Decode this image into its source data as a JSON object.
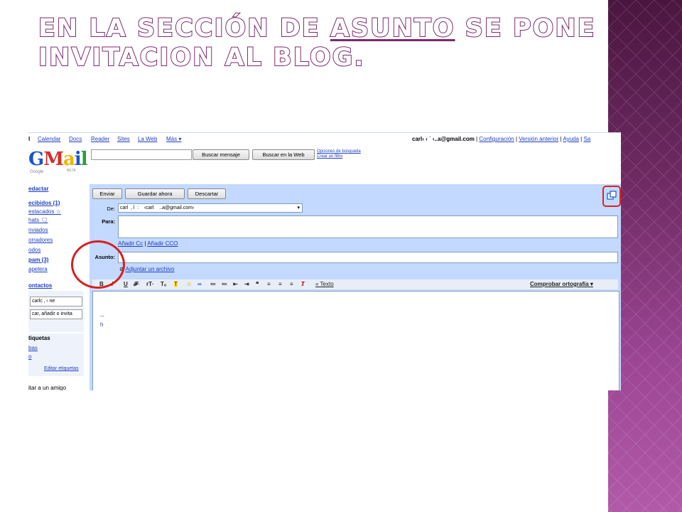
{
  "slide": {
    "title_before": "En la sección de ",
    "title_highlight": "asunto",
    "title_after": " se pone invitacion al blog.",
    "accent": "#7b2a6f",
    "band_color": "#9b4593"
  },
  "gmail": {
    "topnav": [
      "l",
      "Calendar",
      "Docs",
      "Reader",
      "Sites",
      "La Web",
      "Más ▾"
    ],
    "user_email": "carl‹ ‹ ˙ ‹..a@gmail.com",
    "user_links": [
      "Configuración",
      "Versión anterior",
      "Ayuda",
      "Sa"
    ],
    "logo": {
      "text_g": "G",
      "text_m": "M",
      "text_a": "a",
      "text_i": "i",
      "text_l": "l",
      "sub": "Google",
      "beta": "BETA"
    },
    "search": {
      "button_mail": "Buscar mensaje",
      "button_web": "Buscar en la Web",
      "options": "Opciones de búsqueda",
      "filter": "Crear un filtro"
    },
    "leftnav": {
      "compose": "edactar",
      "items": [
        "ecibidos (1)",
        "estacados ☆",
        "hats 🗨",
        "nviados",
        "orradores",
        "odos",
        "pam (3)",
        "apelera"
      ],
      "contacts_title": "ontactos",
      "contact_chip": "carlc  ‚   ‹ ne",
      "contact_search": "car, añadir o invita",
      "labels_title": "tiquetas",
      "label_items": [
        "bas",
        "o"
      ],
      "edit_labels": "Editar etiquetas",
      "invite": "itar a un amigo"
    },
    "compose": {
      "send": "Enviar",
      "save": "Guardar ahora",
      "discard": "Descartar",
      "from_label": "De:",
      "from_value": "carl  ‚ l  :    ‹carl    ..a@gmail.com›",
      "to_label": "Para:",
      "add_cc": "Añadir Cc",
      "add_bcc": "Añadir CCO",
      "subject_label": "Asunto:",
      "attach": "Adjuntar un archivo",
      "format_tools": [
        "B",
        "I",
        "U",
        "𝓕·",
        "rT·",
        "Tₒ",
        "T",
        "☺",
        "∞",
        "≔",
        "≔",
        "⇤",
        "⇥",
        "❝",
        "≡",
        "≡",
        "≡",
        "Ⱦ"
      ],
      "plain_text": "« Texto",
      "spellcheck": "Comprobar ortografía ▾",
      "body_lines": [
        "--",
        "h"
      ]
    }
  }
}
